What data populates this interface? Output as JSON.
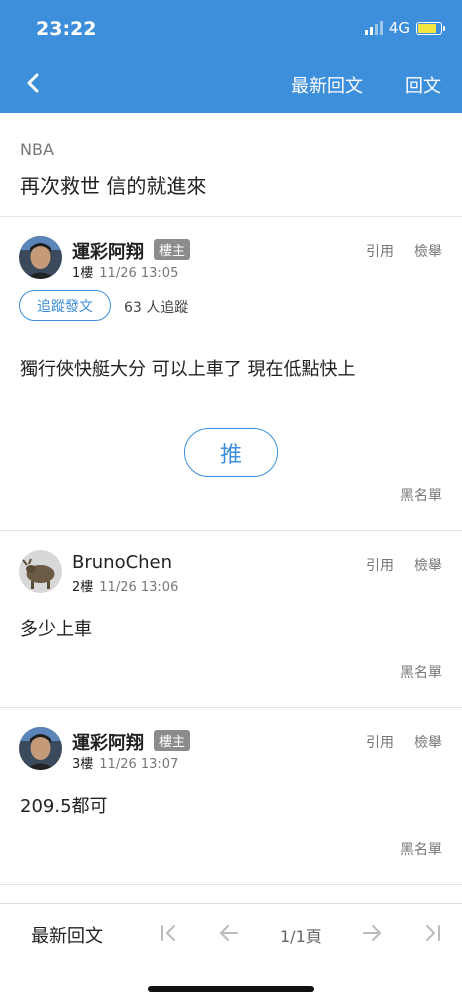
{
  "status": {
    "time": "23:22",
    "network": "4G"
  },
  "header": {
    "latest_reply": "最新回文",
    "reply": "回文"
  },
  "topic": {
    "category": "NBA",
    "title": "再次救世 信的就進來"
  },
  "posts": [
    {
      "author": "運彩阿翔",
      "badge": "樓主",
      "floor": "1樓",
      "date": "11/26 13:05",
      "quote": "引用",
      "report": "檢舉",
      "follow_label": "追蹤發文",
      "followers": "63 人追蹤",
      "body": "獨行俠快艇大分 可以上車了 現在低點快上",
      "push_label": "推",
      "blacklist": "黑名單"
    },
    {
      "author": "BrunoChen",
      "floor": "2樓",
      "date": "11/26 13:06",
      "quote": "引用",
      "report": "檢舉",
      "body": "多少上車",
      "blacklist": "黑名單"
    },
    {
      "author": "運彩阿翔",
      "badge": "樓主",
      "floor": "3樓",
      "date": "11/26 13:07",
      "quote": "引用",
      "report": "檢舉",
      "body": "209.5都可",
      "blacklist": "黑名單"
    }
  ],
  "bottom_bar": {
    "latest_reply": "最新回文",
    "page": "1/1頁"
  },
  "colors": {
    "primary": "#3d8fdb",
    "badge": "#8c8c8c"
  }
}
